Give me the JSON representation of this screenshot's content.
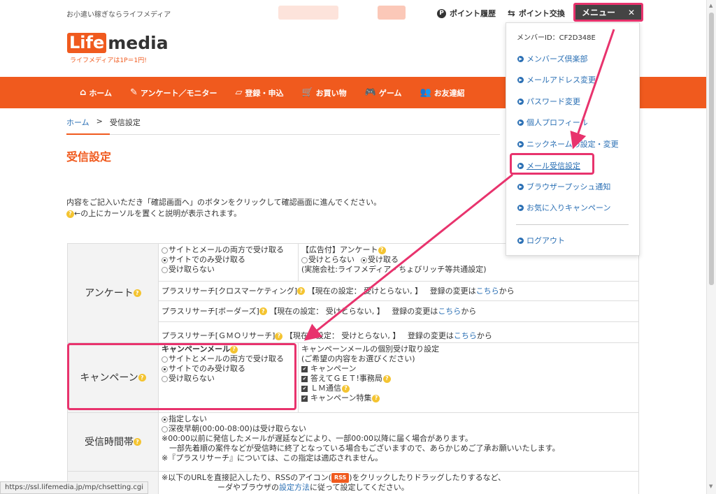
{
  "header": {
    "tagline": "お小遣い稼ぎならライフメディア",
    "point_history": "ポイント履歴",
    "point_exchange": "ポイント交換",
    "menu_label": "メニュー",
    "close_glyph": "✕",
    "logo_life": "Life",
    "logo_media": "media",
    "logo_sub": "ライフメディアは1P＝1円!"
  },
  "nav": {
    "items": [
      {
        "label": "ホーム",
        "icon": "home-icon",
        "glyph": "⌂"
      },
      {
        "label": "アンケート／モニター",
        "icon": "pencil-icon",
        "glyph": "✎"
      },
      {
        "label": "登録・申込",
        "icon": "document-icon",
        "glyph": "▱"
      },
      {
        "label": "お買い物",
        "icon": "cart-icon",
        "glyph": "🛒"
      },
      {
        "label": "ゲーム",
        "icon": "gamepad-icon",
        "glyph": "🎮"
      },
      {
        "label": "お友達紹",
        "icon": "friends-icon",
        "glyph": "👥"
      }
    ]
  },
  "breadcrumb": {
    "home": "ホーム",
    "sep": ">",
    "current": "受信設定"
  },
  "page_title": "受信設定",
  "intro": {
    "line1": "内容をご記入いただき「確認画面へ」のボタンをクリックして確認画面に進んでください。",
    "line2": "←の上にカーソルを置くと説明が表示されます。"
  },
  "survey": {
    "label": "アンケート",
    "options": [
      {
        "label": "サイトとメールの両方で受け取る",
        "selected": false
      },
      {
        "label": "サイトでのみ受け取る",
        "selected": true
      },
      {
        "label": "受け取らない",
        "selected": false
      }
    ],
    "ad_title": "【広告付】アンケート",
    "ad_opt_no": "受けとらない",
    "ad_opt_yes": "受け取る",
    "ad_selected": "yes",
    "ad_company": "(実施会社:ライフメディア・ちょびリッチ等共通設定)",
    "research": [
      {
        "name": "プラスリサーチ[クロスマーケティング]",
        "status": "【現在の設定： 受けとらない, 】",
        "change_pre": "登録の変更は",
        "link": "こちら",
        "change_post": "から"
      },
      {
        "name": "プラスリサーチ[ボーダーズ]",
        "status": "【現在の設定： 受けとらない, 】",
        "change_pre": "登録の変更は",
        "link": "こちら",
        "change_post": "から"
      },
      {
        "name": "プラスリサーチ[ＧＭＯリサーチ]",
        "status": "【現在の設定： 受けとらない, 】",
        "change_pre": "登録の変更は",
        "link": "こちら",
        "change_post": "から"
      }
    ]
  },
  "campaign": {
    "label": "キャンペーン",
    "mail_title": "キャンペーンメール",
    "options": [
      {
        "label": "サイトとメールの両方で受け取る",
        "selected": false
      },
      {
        "label": "サイトでのみ受け取る",
        "selected": true
      },
      {
        "label": "受け取らない",
        "selected": false
      }
    ],
    "individual_title": "キャンペーンメールの個別受け取り設定",
    "individual_sub": "(ご希望の内容をお選びください)",
    "checks": [
      {
        "label": "キャンペーン",
        "checked": true
      },
      {
        "label": "答えてＧＥＴ!事務局",
        "checked": true
      },
      {
        "label": "ＬＭ通信",
        "checked": true
      },
      {
        "label": "キャンペーン特集",
        "checked": true
      }
    ]
  },
  "timezone": {
    "label": "受信時間帯",
    "options": [
      {
        "label": "指定しない",
        "selected": true
      },
      {
        "label": "深夜早朝(00:00-08:00)は受け取らない",
        "selected": false
      }
    ],
    "note1": "※00:00以前に発信したメールが遅延などにより、一部00:00以降に届く場合があります。",
    "note2": "一部先着順の案件などが受信時に終了となっている場合もございますので、あらかじめご了承お願いいたします。",
    "note3": "※『プラスリサーチ』については、この指定は適応されません。"
  },
  "rss": {
    "line1_pre": "※以下のURLを直接記入したり、RSSのアイコン(",
    "rss_label": "RSS",
    "line1_post": ")をクリックしたりドラッグしたりするなど、",
    "line2_pre": "ーダやブラウザの",
    "line2_link": "設定方法",
    "line2_post": "に従って設定してください。"
  },
  "dropdown": {
    "member_id": "メンバーID：CF2D348E",
    "items": [
      "メンバーズ倶楽部",
      "メールアドレス変更",
      "パスワード変更",
      "個人プロフィール",
      "ニックネームの設定・変更",
      "メール受信設定",
      "ブラウザープッシュ通知",
      "お気に入りキャンペーン"
    ],
    "logout": "ログアウト"
  },
  "status_url": "https://ssl.lifemedia.jp/mp/chsetting.cgi",
  "colors": {
    "brand": "#f05a1e",
    "highlight": "#e8336d",
    "link": "#2a6fb4"
  }
}
